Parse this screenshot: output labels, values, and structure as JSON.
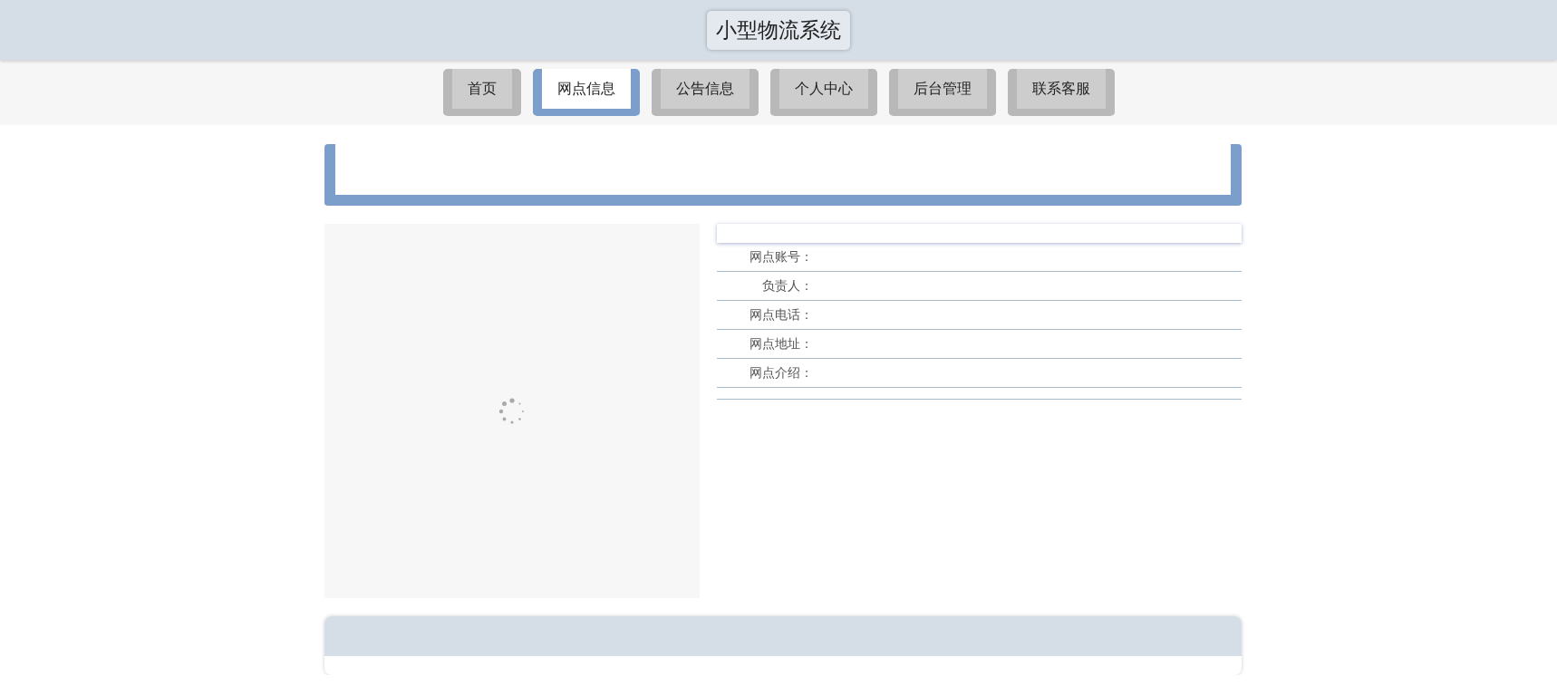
{
  "header": {
    "title": "小型物流系统"
  },
  "nav": [
    {
      "label": "首页",
      "selected": false
    },
    {
      "label": "网点信息",
      "selected": true
    },
    {
      "label": "公告信息",
      "selected": false
    },
    {
      "label": "个人中心",
      "selected": false
    },
    {
      "label": "后台管理",
      "selected": false
    },
    {
      "label": "联系客服",
      "selected": false
    }
  ],
  "detail": {
    "image": {
      "loading": true
    },
    "fields": [
      {
        "label": "网点账号："
      },
      {
        "label": "负责人："
      },
      {
        "label": "网点电话："
      },
      {
        "label": "网点地址："
      },
      {
        "label": "网点介绍："
      }
    ]
  }
}
